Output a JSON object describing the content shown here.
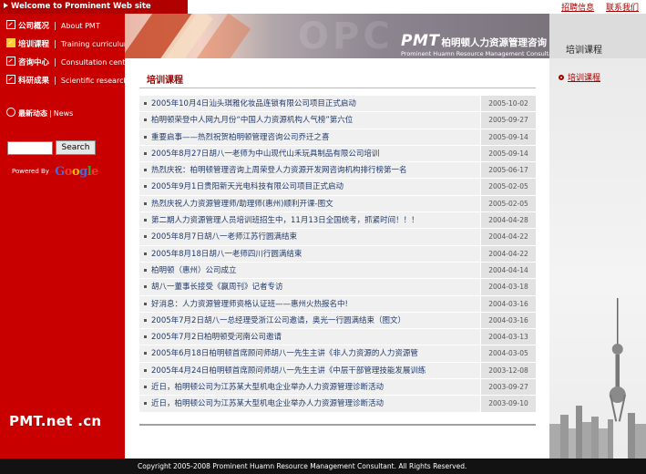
{
  "topbar": {
    "welcome": "Welcome to Prominent  Web site",
    "links": [
      "招聘信息",
      "联系我们"
    ]
  },
  "sidebar": {
    "items": [
      {
        "cn": "公司概况",
        "en": "About PMT",
        "active": false
      },
      {
        "cn": "培训课程",
        "en": "Training curriculum",
        "active": true
      },
      {
        "cn": "咨询中心",
        "en": "Consultation center",
        "active": false
      },
      {
        "cn": "科研成果",
        "en": "Scientific research",
        "active": false
      }
    ],
    "news": {
      "cn": "最新动态",
      "en": "News"
    },
    "search_button": "Search",
    "search_value": "",
    "powered_by": "Powered  By",
    "brand": "PMT.net .cn"
  },
  "banner": {
    "watermark": "OPC",
    "logo_pmt": "PMT",
    "logo_cn": "柏明顿人力资源管理咨询",
    "logo_en": "Prominent Huamn Resource Management Consultant"
  },
  "main": {
    "section_title": "培训课程",
    "news": [
      {
        "title": "2005年10月4日汕头琪雅化妆品连锁有限公司项目正式启动",
        "date": "2005-10-02"
      },
      {
        "title": "柏明顿荣登中人网九月份“中国人力资源机构人气榜”第六位",
        "date": "2005-09-27"
      },
      {
        "title": "重要启事——热烈祝贺柏明顿管理咨询公司乔迁之喜",
        "date": "2005-09-14"
      },
      {
        "title": "2005年8月27日胡八一老师为中山现代山禾玩具制品有限公司培训",
        "date": "2005-09-14"
      },
      {
        "title": "热烈庆祝：柏明顿管理咨询上周荣登人力资源开发网咨询机构排行榜第一名",
        "date": "2005-06-17"
      },
      {
        "title": "2005年9月1日贵阳新天光电科技有限公司项目正式启动",
        "date": "2005-02-05"
      },
      {
        "title": "热烈庆祝人力资源管理师/助理师(惠州)顺利开课-图文",
        "date": "2005-02-05"
      },
      {
        "title": "第二期人力资源管理人员培训班招生中，11月13日全国统考，抓紧时间！！！",
        "date": "2004-04-28"
      },
      {
        "title": "2005年8月7日胡八一老师江苏行圆满结束",
        "date": "2004-04-22"
      },
      {
        "title": "2005年8月18日胡八一老师四川行圆满结束",
        "date": "2004-04-22"
      },
      {
        "title": "柏明顿（惠州）公司成立",
        "date": "2004-04-14"
      },
      {
        "title": "胡八一董事长接受《赢周刊》记者专访",
        "date": "2004-03-18"
      },
      {
        "title": "好消息：人力资源管理师资格认证班——惠州火热报名中!",
        "date": "2004-03-16"
      },
      {
        "title": "2005年7月2日胡八一总经理受浙江公司邀请，奥光一行圆满结束（图文）",
        "date": "2004-03-16"
      },
      {
        "title": "2005年7月2日柏明顿受河南公司邀请",
        "date": "2004-03-13"
      },
      {
        "title": "2005年6月18日柏明顿首席顾问师胡八一先生主讲《非人力资源的人力资源管",
        "date": "2004-03-05"
      },
      {
        "title": "2005年4月24日柏明顿首席顾问师胡八一先生主讲《中层干部管理技能发展训练",
        "date": "2003-12-08"
      },
      {
        "title": "近日，柏明顿公司为江苏某大型机电企业举办人力资源管理诊断活动",
        "date": "2003-09-27"
      },
      {
        "title": "近日，柏明顿公司为江苏某大型机电企业举办人力资源管理诊断活动",
        "date": "2003-09-10"
      }
    ]
  },
  "right": {
    "title": "培训课程",
    "link": "培训课程"
  },
  "footer": {
    "copyright": "Copyright 2005-2008 Prominent Huamn Resource Management Consultant. All Rights Reserved."
  },
  "colors": {
    "sidebar_red": "#c80000",
    "title_red": "#a30000",
    "link_blue": "#213a6b",
    "footer_bg": "#121212"
  }
}
